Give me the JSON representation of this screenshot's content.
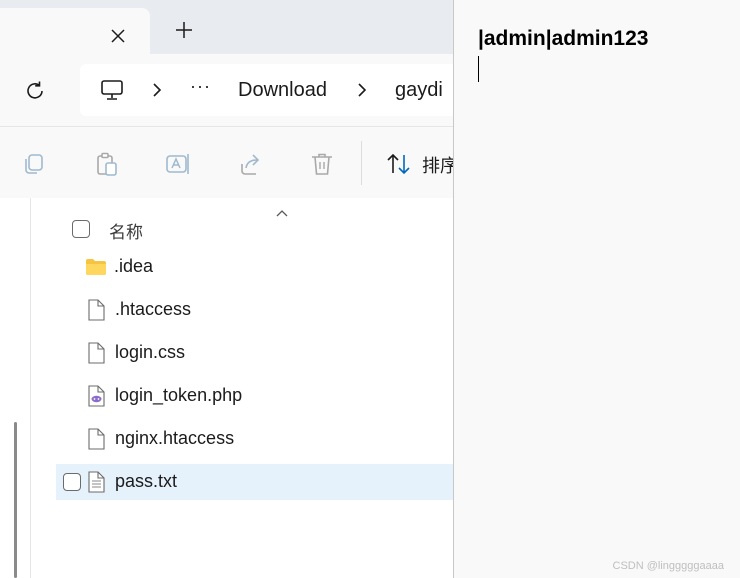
{
  "explorer": {
    "tab": {
      "close_icon": "close-icon",
      "new_tab_icon": "plus-icon"
    },
    "address_bar": {
      "refresh_icon": "refresh-icon",
      "root_icon": "computer-icon",
      "overflow": "···",
      "crumbs": [
        "Download",
        "gaydi"
      ]
    },
    "toolbar": {
      "buttons": [
        "copy-icon",
        "paste-icon",
        "rename-icon",
        "share-icon",
        "delete-icon"
      ],
      "sort_label": "排序"
    },
    "column_header": {
      "name": "名称"
    },
    "files": [
      {
        "name": ".idea",
        "type": "folder-icon",
        "selected": false
      },
      {
        "name": ".htaccess",
        "type": "file-icon",
        "selected": false
      },
      {
        "name": "login.css",
        "type": "file-icon",
        "selected": false
      },
      {
        "name": "login_token.php",
        "type": "php-file-icon",
        "selected": false
      },
      {
        "name": "nginx.htaccess",
        "type": "file-icon",
        "selected": false
      },
      {
        "name": "pass.txt",
        "type": "text-file-icon",
        "selected": true
      }
    ]
  },
  "notepad": {
    "content": "|admin|admin123"
  },
  "watermark": "CSDN @lingggggaaaa",
  "colors": {
    "selection": "#e5f1fb",
    "accent": "#0067c0"
  }
}
